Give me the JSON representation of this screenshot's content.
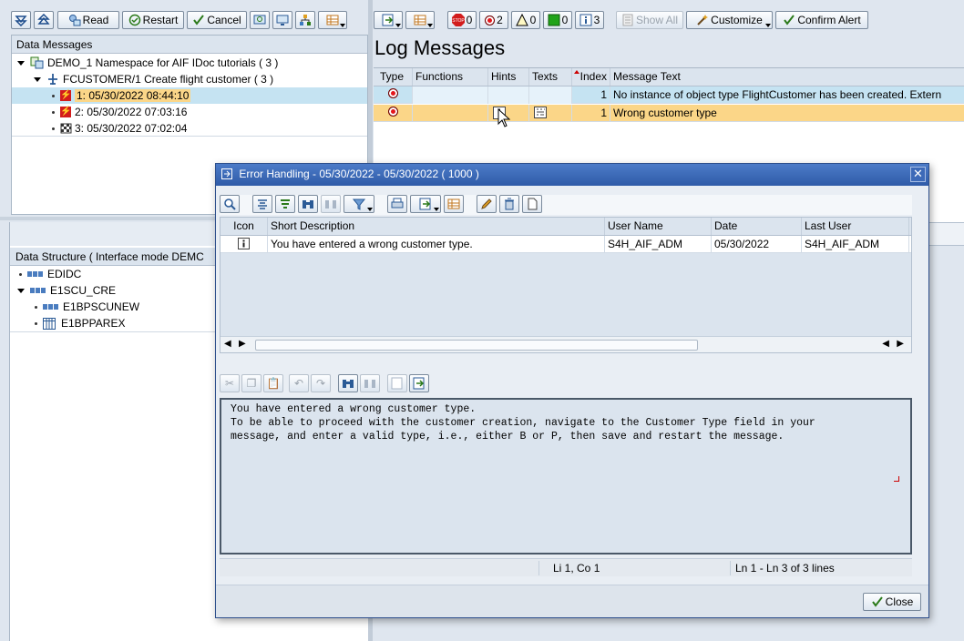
{
  "left_toolbar": {
    "read": "Read",
    "restart": "Restart",
    "cancel": "Cancel"
  },
  "data_messages": {
    "title": "Data Messages",
    "namespace": "DEMO_1 Namespace for AIF IDoc tutorials ( 3  )",
    "interface": "FCUSTOMER/1 Create flight customer ( 3  )",
    "messages": [
      {
        "label": "1: 05/30/2022 08:44:10"
      },
      {
        "label": "2: 05/30/2022 07:03:16"
      },
      {
        "label": "3: 05/30/2022 07:02:04"
      }
    ]
  },
  "data_structure": {
    "title": "Data Structure ( Interface mode DEMC",
    "items": [
      "EDIDC",
      "E1SCU_CRE",
      "E1BPSCUNEW",
      "E1BPPAREX"
    ]
  },
  "right_toolbar": {
    "count_stop": "0",
    "count_error": "2",
    "count_warning": "0",
    "count_success": "0",
    "count_info": "3",
    "show_all": "Show All",
    "customize": "Customize",
    "confirm_alert": "Confirm Alert"
  },
  "log": {
    "title": "Log Messages",
    "columns": [
      "Type",
      "Functions",
      "Hints",
      "Texts",
      "Index",
      "Message Text"
    ],
    "rows": [
      {
        "index": "1",
        "text": "No instance of object type FlightCustomer has been created. Extern"
      },
      {
        "index": "1",
        "text": "Wrong customer type"
      }
    ]
  },
  "dialog": {
    "title": "Error Handling - 05/30/2022 - 05/30/2022 ( 1000 )",
    "columns": [
      "Icon",
      "Short Description",
      "User Name",
      "Date",
      "Last User"
    ],
    "rows": [
      {
        "desc": "You have entered a wrong customer type.",
        "user": "S4H_AIF_ADM",
        "date": "05/30/2022",
        "last_user": "S4H_AIF_ADM"
      }
    ],
    "text_lines": [
      "You have entered a wrong customer type.",
      "To be able to proceed with the customer creation, navigate to the Customer Type field in your",
      "message, and enter a valid type, i.e., either B or P, then save and restart the message."
    ],
    "cursor_pos": "Li 1, Co 1",
    "line_info": "Ln 1 - Ln 3 of 3 lines",
    "close": "Close"
  },
  "colors": {
    "selected_row": "#fbd688",
    "highlight_row": "#c5e3f2",
    "dialog_title": "#3a66b6",
    "error_red": "#d21c1c"
  }
}
